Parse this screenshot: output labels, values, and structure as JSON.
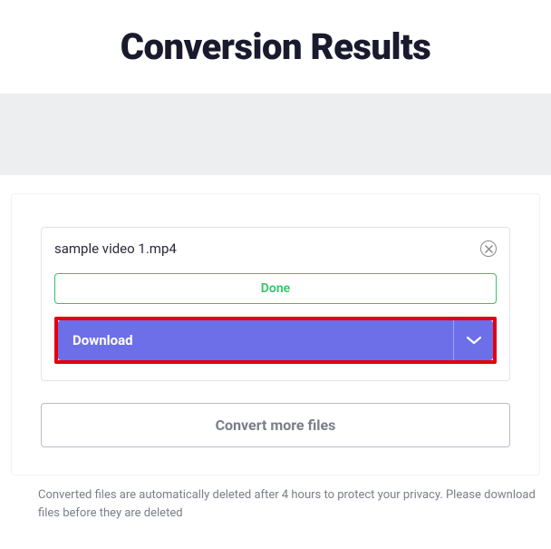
{
  "title": "Conversion Results",
  "file": {
    "name": "sample video 1.mp4",
    "status": "Done"
  },
  "buttons": {
    "download": "Download",
    "convertMore": "Convert more files"
  },
  "footer": "Converted files are automatically deleted after 4 hours to protect your privacy. Please download files before they are deleted",
  "colors": {
    "accent": "#6c6fe8",
    "success": "#34c36a",
    "highlight": "#e3000f"
  }
}
